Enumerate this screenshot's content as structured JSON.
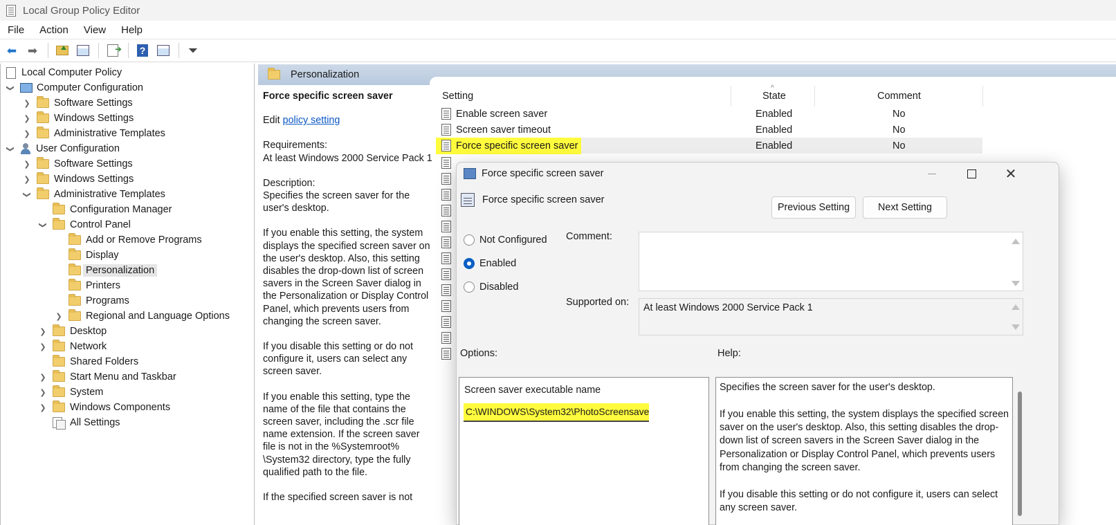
{
  "window": {
    "title": "Local Group Policy Editor"
  },
  "menu": [
    "File",
    "Action",
    "View",
    "Help"
  ],
  "toolbar": {
    "buttons": [
      "back-icon",
      "forward-icon",
      "up-folder-icon",
      "show-hide-tree-icon",
      "export-list-icon",
      "help-icon",
      "properties-view-icon",
      "filter-icon"
    ],
    "help_glyph": "?"
  },
  "tree": {
    "root": "Local Computer Policy",
    "computer_configuration": "Computer Configuration",
    "cc_software": "Software Settings",
    "cc_windows": "Windows Settings",
    "cc_admin": "Administrative Templates",
    "user_configuration": "User Configuration",
    "uc_software": "Software Settings",
    "uc_windows": "Windows Settings",
    "uc_admin": "Administrative Templates",
    "config_manager": "Configuration Manager",
    "control_panel": "Control Panel",
    "add_remove": "Add or Remove Programs",
    "display": "Display",
    "personalization": "Personalization",
    "printers": "Printers",
    "programs": "Programs",
    "regional": "Regional and Language Options",
    "desktop": "Desktop",
    "network": "Network",
    "shared_folders": "Shared Folders",
    "start_menu": "Start Menu and Taskbar",
    "system": "System",
    "windows_components": "Windows Components",
    "all_settings": "All Settings"
  },
  "right_header": {
    "title": "Personalization"
  },
  "description": {
    "title": "Force specific screen saver",
    "edit_prefix": "Edit",
    "edit_link": "policy setting",
    "requirements_label": "Requirements:",
    "requirements": "At least Windows 2000 Service Pack 1",
    "description_label": "Description:",
    "p1": "Specifies the screen saver for the user's desktop.",
    "p2": "If you enable this setting, the system displays the specified screen saver on the user's desktop. Also, this setting disables the drop-down list of screen savers in the Screen Saver dialog in the Personalization or Display Control Panel, which prevents users from changing the screen saver.",
    "p3": "If you disable this setting or do not configure it, users can select any screen saver.",
    "p4": "If you enable this setting, type the name of the file that contains the screen saver, including the .scr file name extension. If the screen saver file is not in the %Systemroot% \\System32 directory, type the fully qualified path to the file.",
    "p5": "If the specified screen saver is not"
  },
  "list": {
    "columns": {
      "setting": "Setting",
      "state": "State",
      "comment": "Comment"
    },
    "rows": [
      {
        "name": "Enable screen saver",
        "state": "Enabled",
        "comment": "No"
      },
      {
        "name": "Screen saver timeout",
        "state": "Enabled",
        "comment": "No"
      },
      {
        "name": "Force specific screen saver",
        "state": "Enabled",
        "comment": "No"
      }
    ]
  },
  "dialog": {
    "title": "Force specific screen saver",
    "setting_name": "Force specific screen saver",
    "prev_button": "Previous Setting",
    "next_button": "Next Setting",
    "radio": {
      "not_configured": "Not Configured",
      "enabled": "Enabled",
      "disabled": "Disabled",
      "selected": "Enabled"
    },
    "comment_label": "Comment:",
    "comment_value": "",
    "supported_label": "Supported on:",
    "supported_value": "At least Windows 2000 Service Pack 1",
    "options_label": "Options:",
    "help_label": "Help:",
    "exe_label": "Screen saver executable name",
    "exe_value": "C:\\WINDOWS\\System32\\PhotoScreensave",
    "help_p1": "Specifies the screen saver for the user's desktop.",
    "help_p2": "If you enable this setting, the system displays the specified screen saver on the user's desktop. Also, this setting disables the drop-down list of screen savers in the Screen Saver dialog in the Personalization or Display Control Panel, which prevents users from changing the screen saver.",
    "help_p3": "If you disable this setting or do not configure it, users can select any screen saver."
  },
  "colors": {
    "highlight": "#fffb3d",
    "accent": "#0a5fc4",
    "link": "#0b57c4",
    "header_band": "#c3d2e4"
  }
}
